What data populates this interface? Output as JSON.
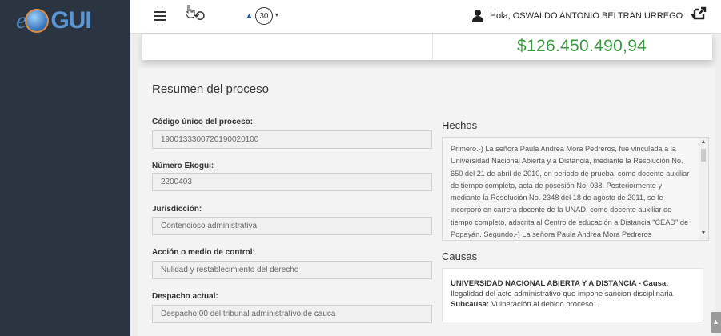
{
  "logo": {
    "prefix": "e",
    "suffix": "GUI"
  },
  "topbar": {
    "notifications_count": "30",
    "user_greeting": "Hola, OSWALDO ANTONIO BELTRAN URREGO"
  },
  "summary": {
    "amount": "$126.450.490,94"
  },
  "process": {
    "section_title": "Resumen del proceso",
    "fields": [
      {
        "label": "Código único del proceso:",
        "value": "19001333007201900201​00"
      },
      {
        "label": "Número Ekogui:",
        "value": "2200403"
      },
      {
        "label": "Jurisdicción:",
        "value": "Contencioso administrativa"
      },
      {
        "label": "Acción o medio de control:",
        "value": "Nulidad y restablecimiento del derecho"
      },
      {
        "label": "Despacho actual:",
        "value": "Despacho 00 del tribunal administrativo de cauca"
      }
    ]
  },
  "hechos": {
    "title": "Hechos",
    "text": "Primero.-) La señora Paula Andrea Mora Pedreros, fue vinculada a la Universidad Nacional Abierta y a Distancia, mediante la Resolución No. 650 del 21 de abril de 2010, en periodo de prueba, como docente auxiliar de tiempo completo, acta de posesión No. 038. Posteriormente y mediante la Resolución No. 2348 del 18 de agosto de 2011, se le incorporó en carrera docente de la UNAD, como docente auxiliar de tiempo completo, adscrita al Centro de educación a Distancia \"CEAD\" de Popayán. Segundo.-) La señora Paula Andrea Mora Pedreros"
  },
  "causas": {
    "title": "Causas",
    "entity_line": "UNIVERSIDAD NACIONAL ABIERTA Y A DISTANCIA - Causa:",
    "cause_text": "Ilegalidad del acto administrativo que impone sancion disciplinaria",
    "subcause_label": "Subcausa:",
    "subcause_text": "Vulneración al debido proceso. ."
  },
  "colors": {
    "sidebar": "#2b3542",
    "amount_green": "#3a9a3e",
    "accent_blue": "#2b5f9a"
  }
}
